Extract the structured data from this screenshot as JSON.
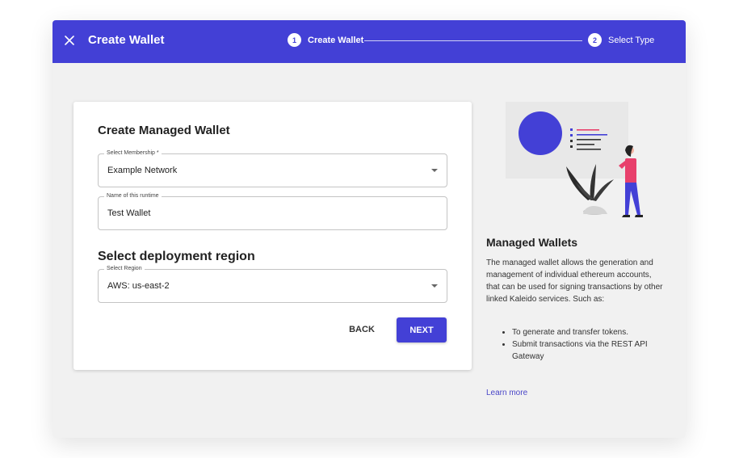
{
  "header": {
    "title": "Create Wallet",
    "close_icon": "close-icon",
    "steps": [
      {
        "number": "1",
        "label": "Create Wallet",
        "active": true
      },
      {
        "number": "2",
        "label": "Select Type",
        "active": false
      }
    ]
  },
  "form": {
    "title": "Create Managed Wallet",
    "membership": {
      "label": "Select Membership *",
      "value": "Example Network"
    },
    "runtime_name": {
      "label": "Name of this runtime",
      "value": "Test Wallet"
    },
    "region_section_title": "Select deployment region",
    "region": {
      "label": "Select Region",
      "value": "AWS: us-east-2"
    },
    "back_label": "BACK",
    "next_label": "NEXT"
  },
  "side": {
    "title": "Managed Wallets",
    "description": "The managed wallet allows the generation and management of individual ethereum accounts, that can be used for signing transactions by other linked Kaleido services. Such as:",
    "bullets": [
      "To generate and transfer tokens.",
      "Submit transactions via the REST API Gateway"
    ],
    "learn_more": "Learn more"
  },
  "colors": {
    "accent": "#4340d6",
    "illustration_pink": "#e8406c",
    "link": "#4a46c8"
  }
}
